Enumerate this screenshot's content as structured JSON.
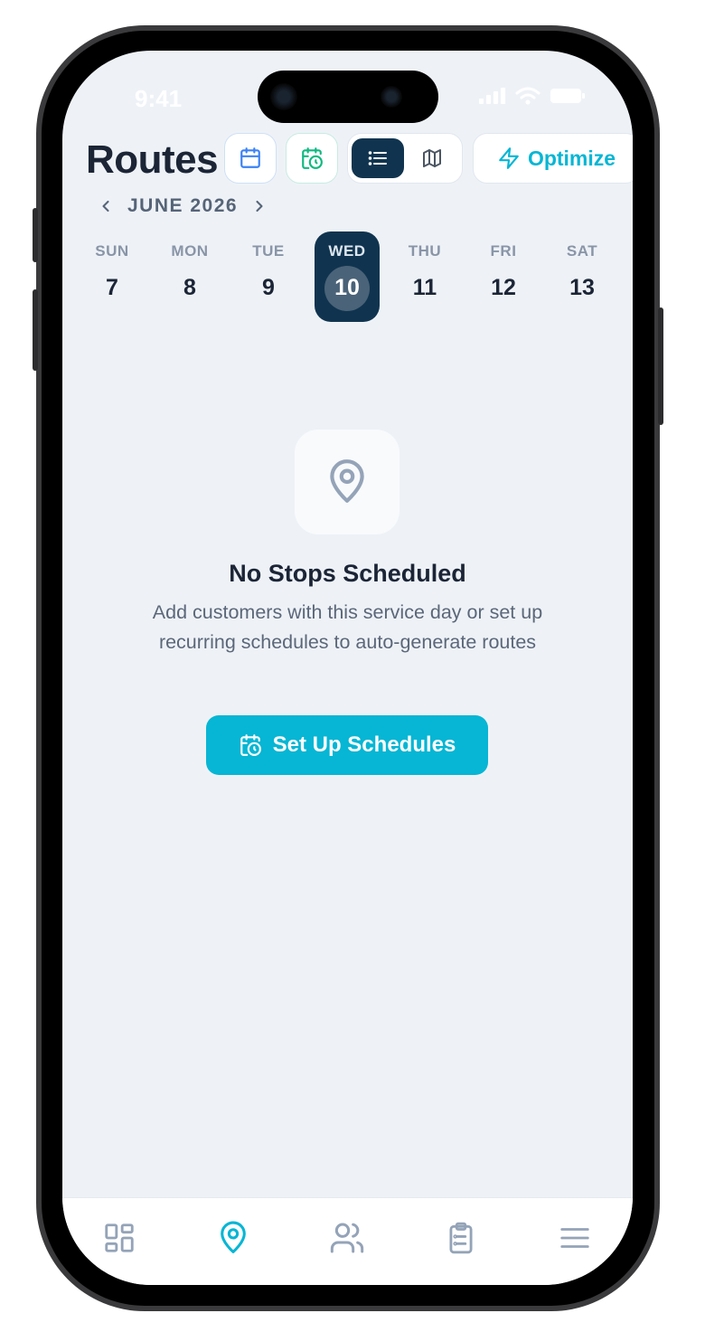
{
  "status_bar": {
    "time": "9:41"
  },
  "header": {
    "title": "Routes",
    "optimize_label": "Optimize"
  },
  "calendar": {
    "month_label": "JUNE 2026",
    "days": [
      {
        "name": "SUN",
        "date": "7"
      },
      {
        "name": "MON",
        "date": "8"
      },
      {
        "name": "TUE",
        "date": "9"
      },
      {
        "name": "WED",
        "date": "10"
      },
      {
        "name": "THU",
        "date": "11"
      },
      {
        "name": "FRI",
        "date": "12"
      },
      {
        "name": "SAT",
        "date": "13"
      }
    ],
    "selected_day": "WED"
  },
  "empty_state": {
    "icon": "map-pin-icon",
    "title": "No Stops Scheduled",
    "description": "Add customers with this service day or set up recurring schedules to auto-generate routes",
    "cta_label": "Set Up Schedules"
  },
  "tab_bar": {
    "items": [
      {
        "icon": "dashboard-grid-icon"
      },
      {
        "icon": "map-pin-icon",
        "active": true
      },
      {
        "icon": "users-icon"
      },
      {
        "icon": "clipboard-list-icon"
      },
      {
        "icon": "menu-icon"
      }
    ]
  },
  "colors": {
    "accent": "#06b6d4",
    "navy": "#10344f",
    "background": "#eef2f7",
    "text_primary": "#1b2536",
    "text_muted": "#8995a7"
  }
}
